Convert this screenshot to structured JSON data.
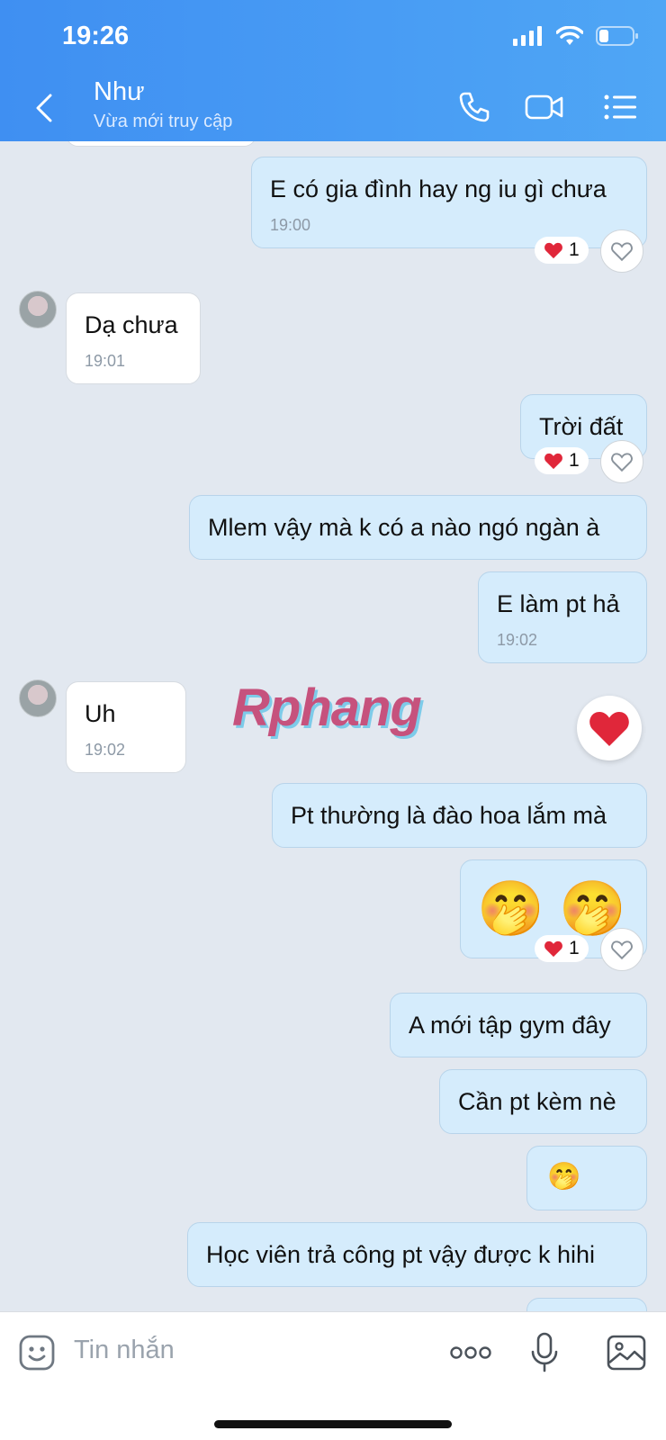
{
  "status_bar": {
    "time": "19:26"
  },
  "header": {
    "name": "Như",
    "status": "Vừa mới truy cập"
  },
  "messages": [
    {
      "text": "E có gia đình hay ng iu gì chưa",
      "time": "19:00",
      "reaction_count": "1"
    },
    {
      "text": "Dạ chưa",
      "time": "19:01"
    },
    {
      "text": "Trời đất",
      "reaction_count": "1"
    },
    {
      "text": "Mlem vậy mà k có a nào ngó ngàn à"
    },
    {
      "text": "E làm pt hả",
      "time": "19:02"
    },
    {
      "text": "Uh",
      "time": "19:02"
    },
    {
      "text": "Pt thường là đào hoa lắm mà"
    },
    {
      "text": "🤭 🤭",
      "reaction_count": "1"
    },
    {
      "text": "A mới tập gym đây"
    },
    {
      "text": "Cần pt kèm nè"
    },
    {
      "text": "🤭"
    },
    {
      "text": "Học viên trả công pt vậy được k hihi"
    }
  ],
  "watermark": "Rphang",
  "input": {
    "placeholder": "Tin nhắn"
  },
  "icons": {
    "back": "chevron-left-icon",
    "call": "phone-icon",
    "video": "video-camera-icon",
    "menu": "list-icon",
    "emoji": "emoji-icon",
    "more": "more-dots-icon",
    "mic": "microphone-icon",
    "image": "image-icon",
    "heart": "heart-icon",
    "like": "heart-outline-icon"
  },
  "colors": {
    "header": "#4a9bf4",
    "outgoing_bubble": "#d5ecfc",
    "incoming_bubble": "#ffffff",
    "background": "#e2e8f0"
  }
}
